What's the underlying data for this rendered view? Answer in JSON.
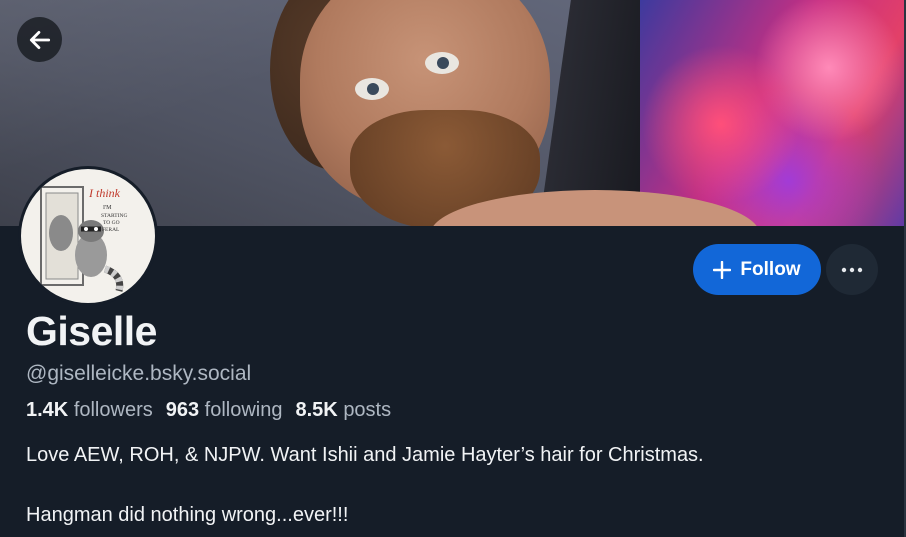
{
  "profile": {
    "display_name": "Giselle",
    "handle": "@giselleicke.bsky.social",
    "stats": {
      "followers_count": "1.4K",
      "followers_label": "followers",
      "following_count": "963",
      "following_label": "following",
      "posts_count": "8.5K",
      "posts_label": "posts"
    },
    "bio": [
      "Love AEW, ROH, & NJPW. Want Ishii and Jamie Hayter’s hair for Christmas.",
      "Hangman did nothing wrong...ever!!!"
    ],
    "avatar_text": "I think I'm starting to go feral"
  },
  "actions": {
    "follow_label": "Follow",
    "follow_icon": "plus-icon",
    "more_icon": "more-horizontal-icon",
    "back_icon": "arrow-left-icon"
  },
  "colors": {
    "background": "#151d28",
    "accent": "#1267d8",
    "text_primary": "#f1f3f5",
    "text_secondary": "#aeb7c2"
  }
}
